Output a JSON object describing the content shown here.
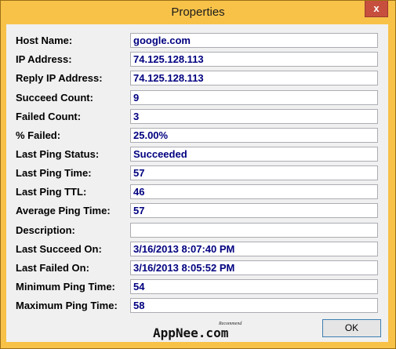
{
  "window": {
    "title": "Properties",
    "close_glyph": "x"
  },
  "fields": [
    {
      "label": "Host Name:",
      "value": "google.com"
    },
    {
      "label": "IP Address:",
      "value": "74.125.128.113"
    },
    {
      "label": "Reply IP Address:",
      "value": "74.125.128.113"
    },
    {
      "label": "Succeed Count:",
      "value": "9"
    },
    {
      "label": "Failed Count:",
      "value": "3"
    },
    {
      "label": "% Failed:",
      "value": "25.00%"
    },
    {
      "label": "Last Ping Status:",
      "value": "Succeeded"
    },
    {
      "label": "Last Ping Time:",
      "value": "57"
    },
    {
      "label": "Last Ping TTL:",
      "value": "46"
    },
    {
      "label": "Average Ping Time:",
      "value": "57"
    },
    {
      "label": "Description:",
      "value": ""
    },
    {
      "label": "Last Succeed On:",
      "value": "3/16/2013 8:07:40 PM"
    },
    {
      "label": "Last Failed On:",
      "value": "3/16/2013 8:05:52 PM"
    },
    {
      "label": "Minimum Ping Time:",
      "value": "54"
    },
    {
      "label": "Maximum Ping Time:",
      "value": "58"
    }
  ],
  "buttons": {
    "ok_label": "OK"
  },
  "watermark": {
    "brand": "AppNee.com",
    "tagline": "Recommend"
  }
}
